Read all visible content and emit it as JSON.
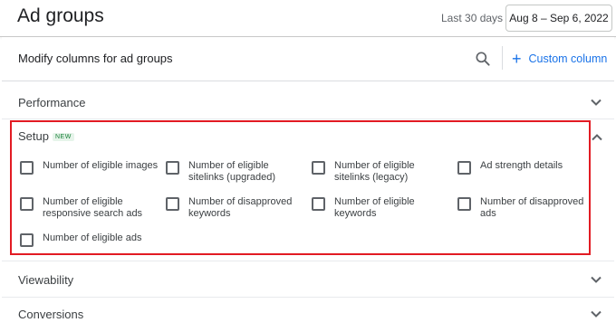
{
  "header": {
    "title": "Ad groups",
    "date_range_label": "Last 30 days",
    "date_range_value": "Aug 8 – Sep 6, 2022"
  },
  "panel": {
    "title": "Modify columns for ad groups",
    "search_icon": "search-icon",
    "custom_column_label": "Custom column"
  },
  "sections": {
    "performance": "Performance",
    "setup": "Setup",
    "setup_badge": "NEW",
    "viewability": "Viewability",
    "conversions": "Conversions"
  },
  "setup_options": [
    {
      "label": "Number of eligible images",
      "checked": false
    },
    {
      "label": "Number of eligible sitelinks (upgraded)",
      "checked": false
    },
    {
      "label": "Number of eligible sitelinks (legacy)",
      "checked": false
    },
    {
      "label": "Ad strength details",
      "checked": false
    },
    {
      "label": "Number of eligible responsive search ads",
      "checked": false
    },
    {
      "label": "Number of disapproved keywords",
      "checked": false
    },
    {
      "label": "Number of eligible keywords",
      "checked": false
    },
    {
      "label": "Number of disapproved ads",
      "checked": false
    },
    {
      "label": "Number of eligible ads",
      "checked": false
    }
  ],
  "colors": {
    "accent": "#1a73e8",
    "highlight_border": "#e21b23",
    "badge_green": "#188038"
  }
}
